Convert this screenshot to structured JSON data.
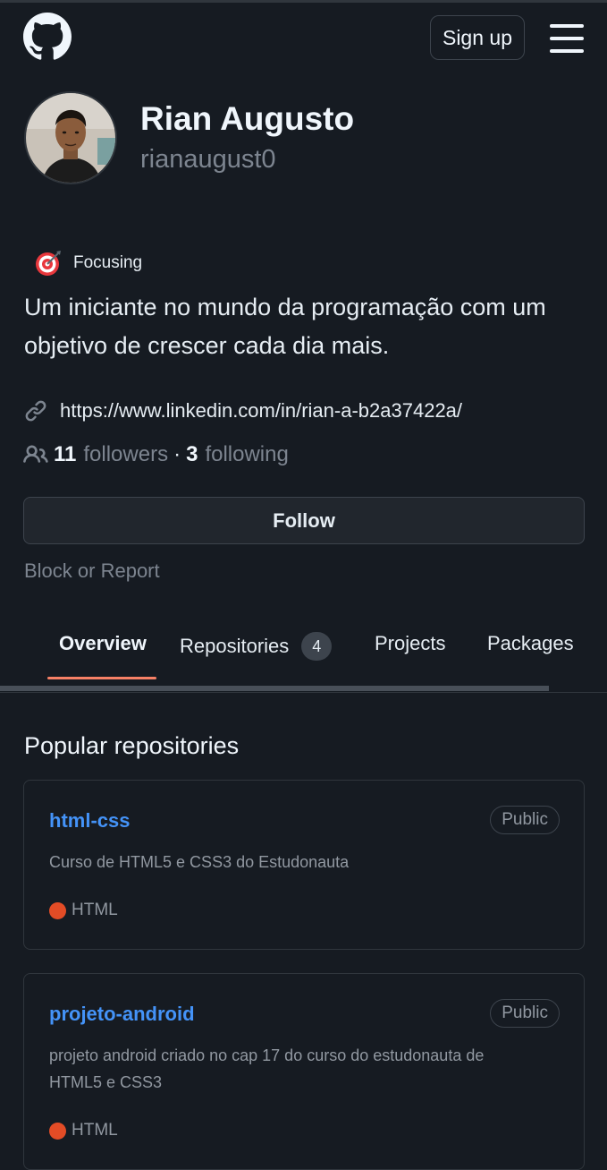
{
  "header": {
    "logo_icon": "github-octocat-icon",
    "signup_label": "Sign up",
    "menu_icon": "hamburger-menu-icon"
  },
  "profile": {
    "name": "Rian Augusto",
    "login": "rianaugust0",
    "status_emoji": "direct-hit-icon",
    "status_text": "Focusing",
    "bio_line1": "Um iniciante no mundo da programação com um",
    "bio_line2": "objetivo de crescer cada dia mais.",
    "link": "https://www.linkedin.com/in/rian-a-b2a37422a/",
    "followers_count": "11",
    "followers_label": "followers",
    "following_count": "3",
    "following_label": "following",
    "separator": "·",
    "follow_label": "Follow",
    "block_label": "Block or Report"
  },
  "tabs": [
    {
      "label": "Overview",
      "active": true
    },
    {
      "label": "Repositories",
      "counter": "4"
    },
    {
      "label": "Projects"
    },
    {
      "label": "Packages"
    }
  ],
  "popular": {
    "title": "Popular repositories",
    "repos": [
      {
        "name": "html-css",
        "visibility": "Public",
        "description_line1": "Curso de HTML5 e CSS3 do Estudonauta",
        "description_line2": "",
        "language": "HTML",
        "language_color": "#e34c26"
      },
      {
        "name": "projeto-android",
        "visibility": "Public",
        "description_line1": "projeto android criado no cap 17 do curso do estudonauta de",
        "description_line2": "HTML5 e CSS3",
        "language": "HTML",
        "language_color": "#e34c26"
      }
    ]
  },
  "colors": {
    "background": "#161b22",
    "link_blue": "#4493f8",
    "tab_underline": "#f78166",
    "html_lang": "#e34c26"
  }
}
